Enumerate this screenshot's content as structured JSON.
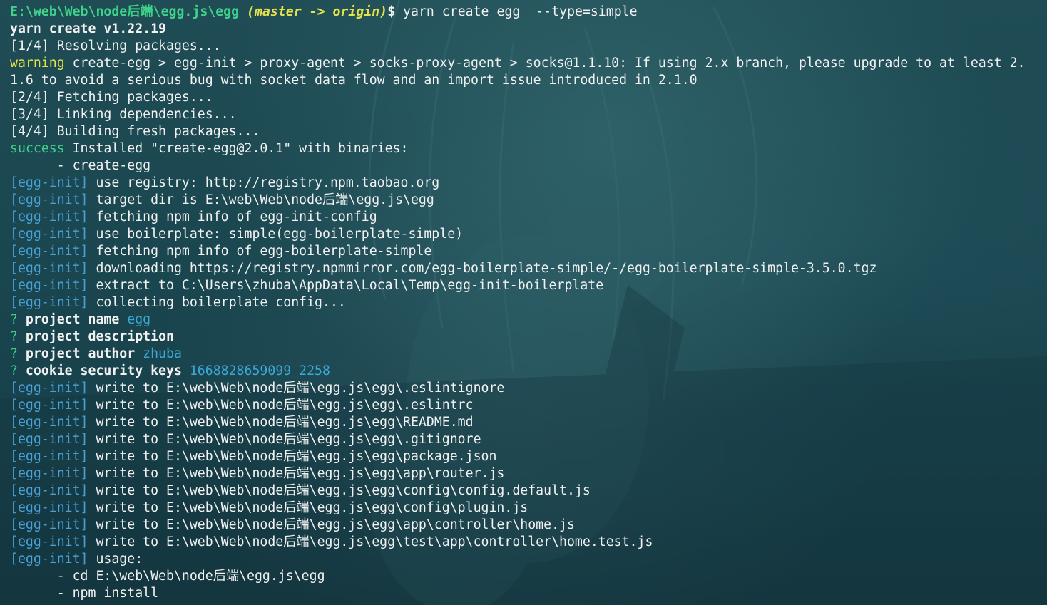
{
  "prompt": {
    "path": "E:\\web\\Web\\node后端\\egg.js\\egg",
    "branch": "(master -> origin)",
    "symbol": "$",
    "command": " yarn create egg  --type=simple"
  },
  "output": {
    "yarn_version": "yarn create v1.22.19",
    "step1": "[1/4] Resolving packages...",
    "warning_label": "warning",
    "warning_msg1": " create-egg > egg-init > proxy-agent > socks-proxy-agent > socks@1.1.10: If using 2.x branch, please upgrade to at least 2.",
    "warning_msg2": "1.6 to avoid a serious bug with socket data flow and an import issue introduced in 2.1.0",
    "step2": "[2/4] Fetching packages...",
    "step3": "[3/4] Linking dependencies...",
    "step4": "[4/4] Building fresh packages...",
    "success_label": "success",
    "success_msg": " Installed \"create-egg@2.0.1\" with binaries:",
    "binary": "      - create-egg",
    "egg_tag": "[egg-init]",
    "egg_lines": [
      " use registry: http://registry.npm.taobao.org",
      " target dir is E:\\web\\Web\\node后端\\egg.js\\egg",
      " fetching npm info of egg-init-config",
      " use boilerplate: simple(egg-boilerplate-simple)",
      " fetching npm info of egg-boilerplate-simple",
      " downloading https://registry.npmmirror.com/egg-boilerplate-simple/-/egg-boilerplate-simple-3.5.0.tgz",
      " extract to C:\\Users\\zhuba\\AppData\\Local\\Temp\\egg-init-boilerplate",
      " collecting boilerplate config..."
    ],
    "questions": [
      {
        "mark": "?",
        "label": " project name ",
        "answer": "egg"
      },
      {
        "mark": "?",
        "label": " project description",
        "answer": ""
      },
      {
        "mark": "?",
        "label": " project author ",
        "answer": "zhuba"
      },
      {
        "mark": "?",
        "label": " cookie security keys ",
        "answer": "1668828659099_2258"
      }
    ],
    "write_lines": [
      " write to E:\\web\\Web\\node后端\\egg.js\\egg\\.eslintignore",
      " write to E:\\web\\Web\\node后端\\egg.js\\egg\\.eslintrc",
      " write to E:\\web\\Web\\node后端\\egg.js\\egg\\README.md",
      " write to E:\\web\\Web\\node后端\\egg.js\\egg\\.gitignore",
      " write to E:\\web\\Web\\node后端\\egg.js\\egg\\package.json",
      " write to E:\\web\\Web\\node后端\\egg.js\\egg\\app\\router.js",
      " write to E:\\web\\Web\\node后端\\egg.js\\egg\\config\\config.default.js",
      " write to E:\\web\\Web\\node后端\\egg.js\\egg\\config\\plugin.js",
      " write to E:\\web\\Web\\node后端\\egg.js\\egg\\app\\controller\\home.js",
      " write to E:\\web\\Web\\node后端\\egg.js\\egg\\test\\app\\controller\\home.test.js"
    ],
    "usage": " usage:",
    "usage_cd": "      - cd E:\\web\\Web\\node后端\\egg.js\\egg",
    "usage_install": "      - npm install"
  },
  "colors": {
    "path": "#3ed28a",
    "branch": "#e6e34a",
    "warning": "#e6e34a",
    "success": "#3ed28a",
    "tag": "#4aa0d6",
    "answer": "#3aa9d6",
    "background": "#1d4850"
  }
}
